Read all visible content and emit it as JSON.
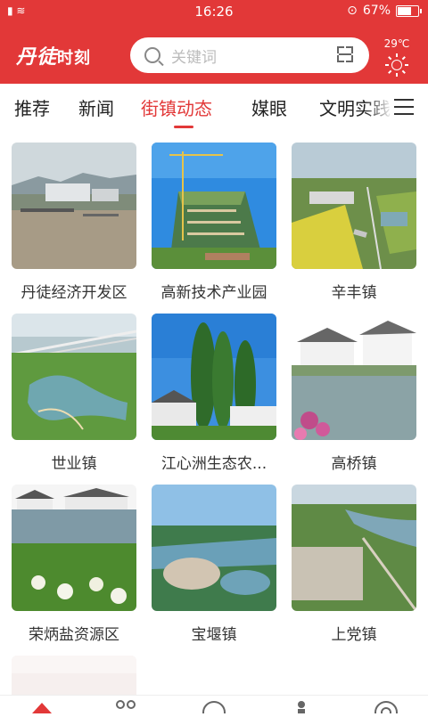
{
  "status": {
    "time": "16:26",
    "battery": "67%",
    "left_icons": "▮ ≋"
  },
  "header": {
    "logo_script": "丹徒",
    "logo_suffix": "时刻",
    "search_placeholder": "关键词",
    "temperature": "29℃"
  },
  "tabs": [
    {
      "label": "推荐",
      "active": false
    },
    {
      "label": "新闻",
      "active": false
    },
    {
      "label": "街镇动态",
      "active": true
    },
    {
      "label": "媒眼",
      "active": false
    },
    {
      "label": "文明实践",
      "active": false
    }
  ],
  "grid": [
    {
      "label": "丹徒经济开发区",
      "scene": "river-port"
    },
    {
      "label": "高新技术产业园",
      "scene": "construction"
    },
    {
      "label": "辛丰镇",
      "scene": "fields-aerial"
    },
    {
      "label": "世业镇",
      "scene": "wetland-bridge"
    },
    {
      "label": "江心洲生态农...",
      "scene": "poplar-trees"
    },
    {
      "label": "高桥镇",
      "scene": "canal-houses"
    },
    {
      "label": "荣炳盐资源区",
      "scene": "lake-flowers"
    },
    {
      "label": "宝堰镇",
      "scene": "island-village"
    },
    {
      "label": "上党镇",
      "scene": "river-village"
    }
  ],
  "bottom_nav": [
    "home-icon",
    "people-icon",
    "circle-icon",
    "person-icon",
    "target-icon"
  ],
  "colors": {
    "brand": "#e23838"
  }
}
